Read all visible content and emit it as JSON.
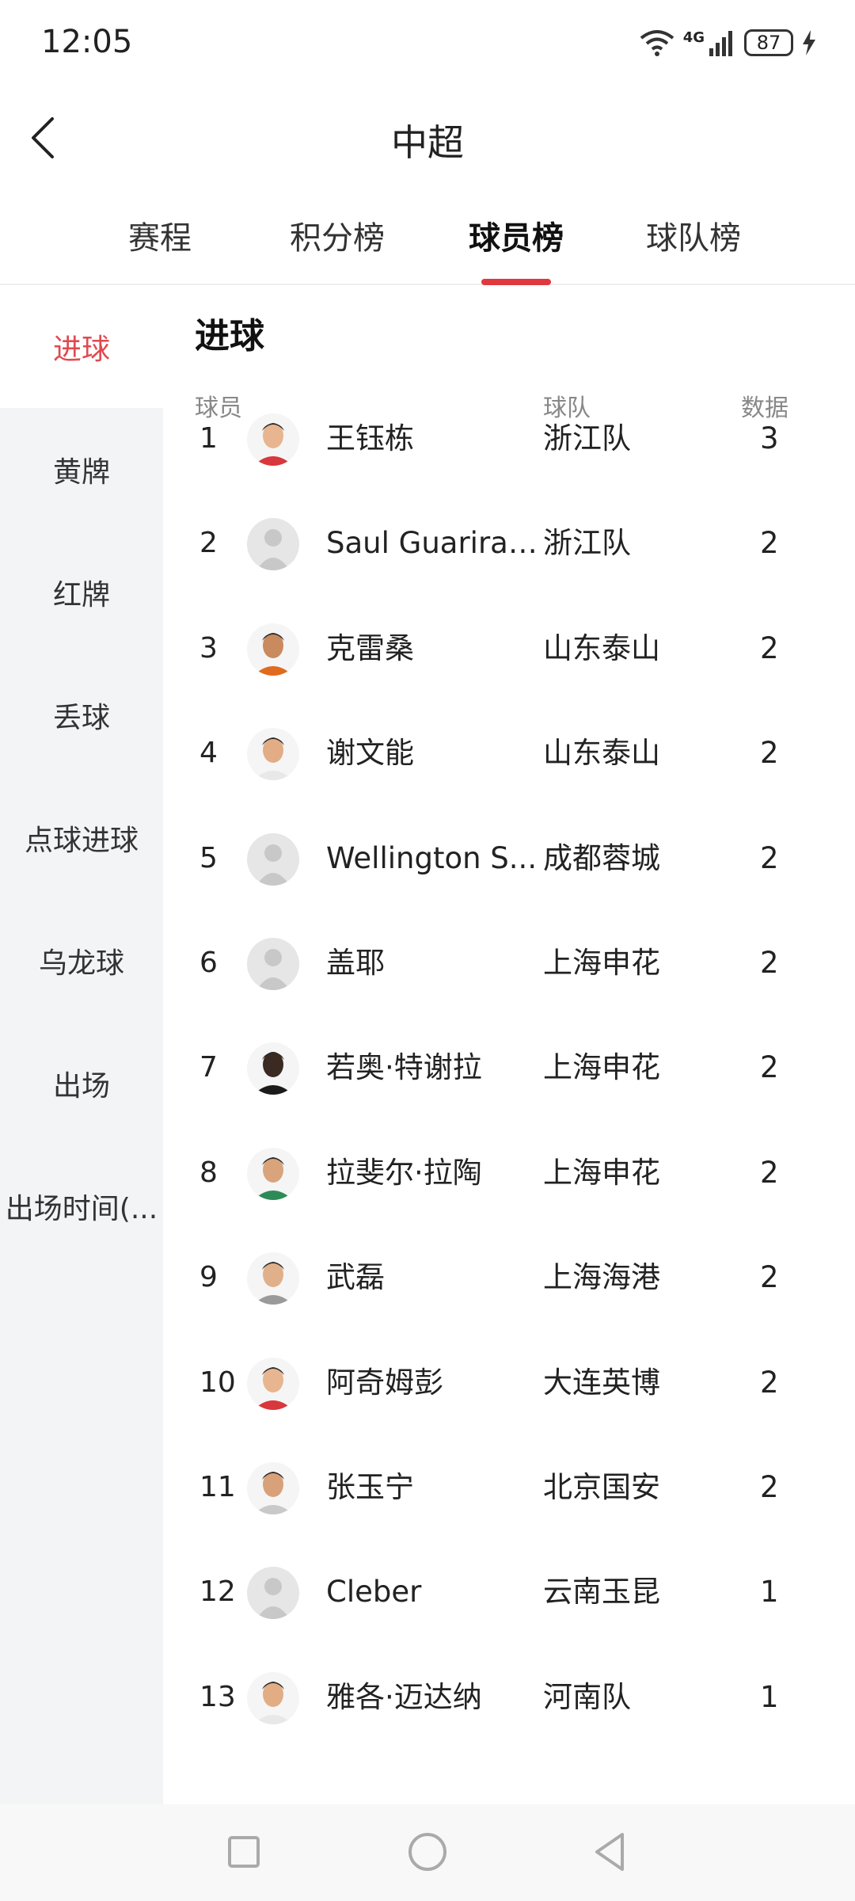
{
  "status_bar": {
    "time": "12:05",
    "network": "4G",
    "battery": "87"
  },
  "header": {
    "title": "中超"
  },
  "tabs": [
    {
      "label": "赛程"
    },
    {
      "label": "积分榜"
    },
    {
      "label": "球员榜"
    },
    {
      "label": "球队榜"
    }
  ],
  "active_tab": "球员榜",
  "sidebar": {
    "items": [
      {
        "label": "进球"
      },
      {
        "label": "黄牌"
      },
      {
        "label": "红牌"
      },
      {
        "label": "丢球"
      },
      {
        "label": "点球进球"
      },
      {
        "label": "乌龙球"
      },
      {
        "label": "出场"
      },
      {
        "label": "出场时间(..."
      }
    ],
    "active": "进球"
  },
  "main": {
    "section_title": "进球",
    "columns": {
      "player": "球员",
      "team": "球队",
      "stat": "数据"
    },
    "rows": [
      {
        "rank": "1",
        "player": "王钰栋",
        "team": "浙江队",
        "value": "3",
        "avatar": "photo"
      },
      {
        "rank": "2",
        "player": "Saul Guarirapa",
        "team": "浙江队",
        "value": "2",
        "avatar": "placeholder"
      },
      {
        "rank": "3",
        "player": "克雷桑",
        "team": "山东泰山",
        "value": "2",
        "avatar": "photo"
      },
      {
        "rank": "4",
        "player": "谢文能",
        "team": "山东泰山",
        "value": "2",
        "avatar": "photo"
      },
      {
        "rank": "5",
        "player": "Wellington S...",
        "team": "成都蓉城",
        "value": "2",
        "avatar": "placeholder"
      },
      {
        "rank": "6",
        "player": "盖耶",
        "team": "上海申花",
        "value": "2",
        "avatar": "placeholder"
      },
      {
        "rank": "7",
        "player": "若奥·特谢拉",
        "team": "上海申花",
        "value": "2",
        "avatar": "photo"
      },
      {
        "rank": "8",
        "player": "拉斐尔·拉陶",
        "team": "上海申花",
        "value": "2",
        "avatar": "photo"
      },
      {
        "rank": "9",
        "player": "武磊",
        "team": "上海海港",
        "value": "2",
        "avatar": "photo"
      },
      {
        "rank": "10",
        "player": "阿奇姆彭",
        "team": "大连英博",
        "value": "2",
        "avatar": "photo"
      },
      {
        "rank": "11",
        "player": "张玉宁",
        "team": "北京国安",
        "value": "2",
        "avatar": "photo"
      },
      {
        "rank": "12",
        "player": "Cleber",
        "team": "云南玉昆",
        "value": "1",
        "avatar": "placeholder"
      },
      {
        "rank": "13",
        "player": "雅各·迈达纳",
        "team": "河南队",
        "value": "1",
        "avatar": "photo"
      }
    ]
  },
  "colors": {
    "accent": "#e0383e",
    "sidebar_bg": "#f3f4f6",
    "active_side_text": "#e04a4f"
  }
}
